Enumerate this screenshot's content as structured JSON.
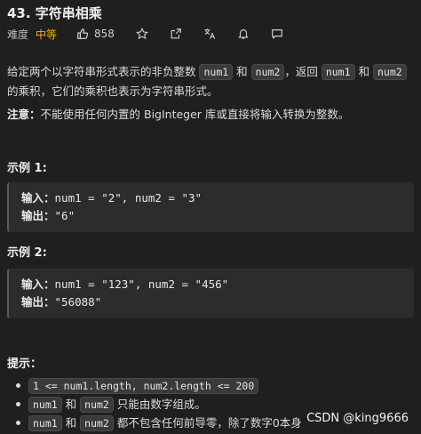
{
  "problem": {
    "title": "43. 字符串相乘",
    "difficulty_label": "难度",
    "difficulty": "中等",
    "likes": "858"
  },
  "description": {
    "p1_a": "给定两个以字符串形式表示的非负整数 ",
    "num1": "num1",
    "p1_b": " 和 ",
    "num2": "num2",
    "p1_c": "，返回 ",
    "p1_d": " 和 ",
    "p1_e": " 的乘积，它们的乘积也表示为字符串形式。",
    "note_label": "注意：",
    "note_text": "不能使用任何内置的 BigInteger 库或直接将输入转换为整数。"
  },
  "examples": [
    {
      "heading": "示例 1:",
      "input_label": "输入：",
      "input": "num1 = \"2\", num2 = \"3\"",
      "output_label": "输出：",
      "output": "\"6\""
    },
    {
      "heading": "示例 2:",
      "input_label": "输入：",
      "input": "num1 = \"123\", num2 = \"456\"",
      "output_label": "输出：",
      "output": "\"56088\""
    }
  ],
  "hints": {
    "heading": "提示：",
    "h1_code": "1 <= num1.length, num2.length <= 200",
    "h2_a": "num1",
    "h2_b": " 和 ",
    "h2_c": "num2",
    "h2_d": " 只能由数字组成。",
    "h3_a": "num1",
    "h3_b": " 和 ",
    "h3_c": "num2",
    "h3_d": " 都不包含任何前导零，除了数字0本身"
  },
  "watermark": "CSDN @king9666",
  "colors": {
    "background": "#1f1f1f",
    "difficulty": "#f4b400",
    "code_bg": "#3a3a3a"
  }
}
